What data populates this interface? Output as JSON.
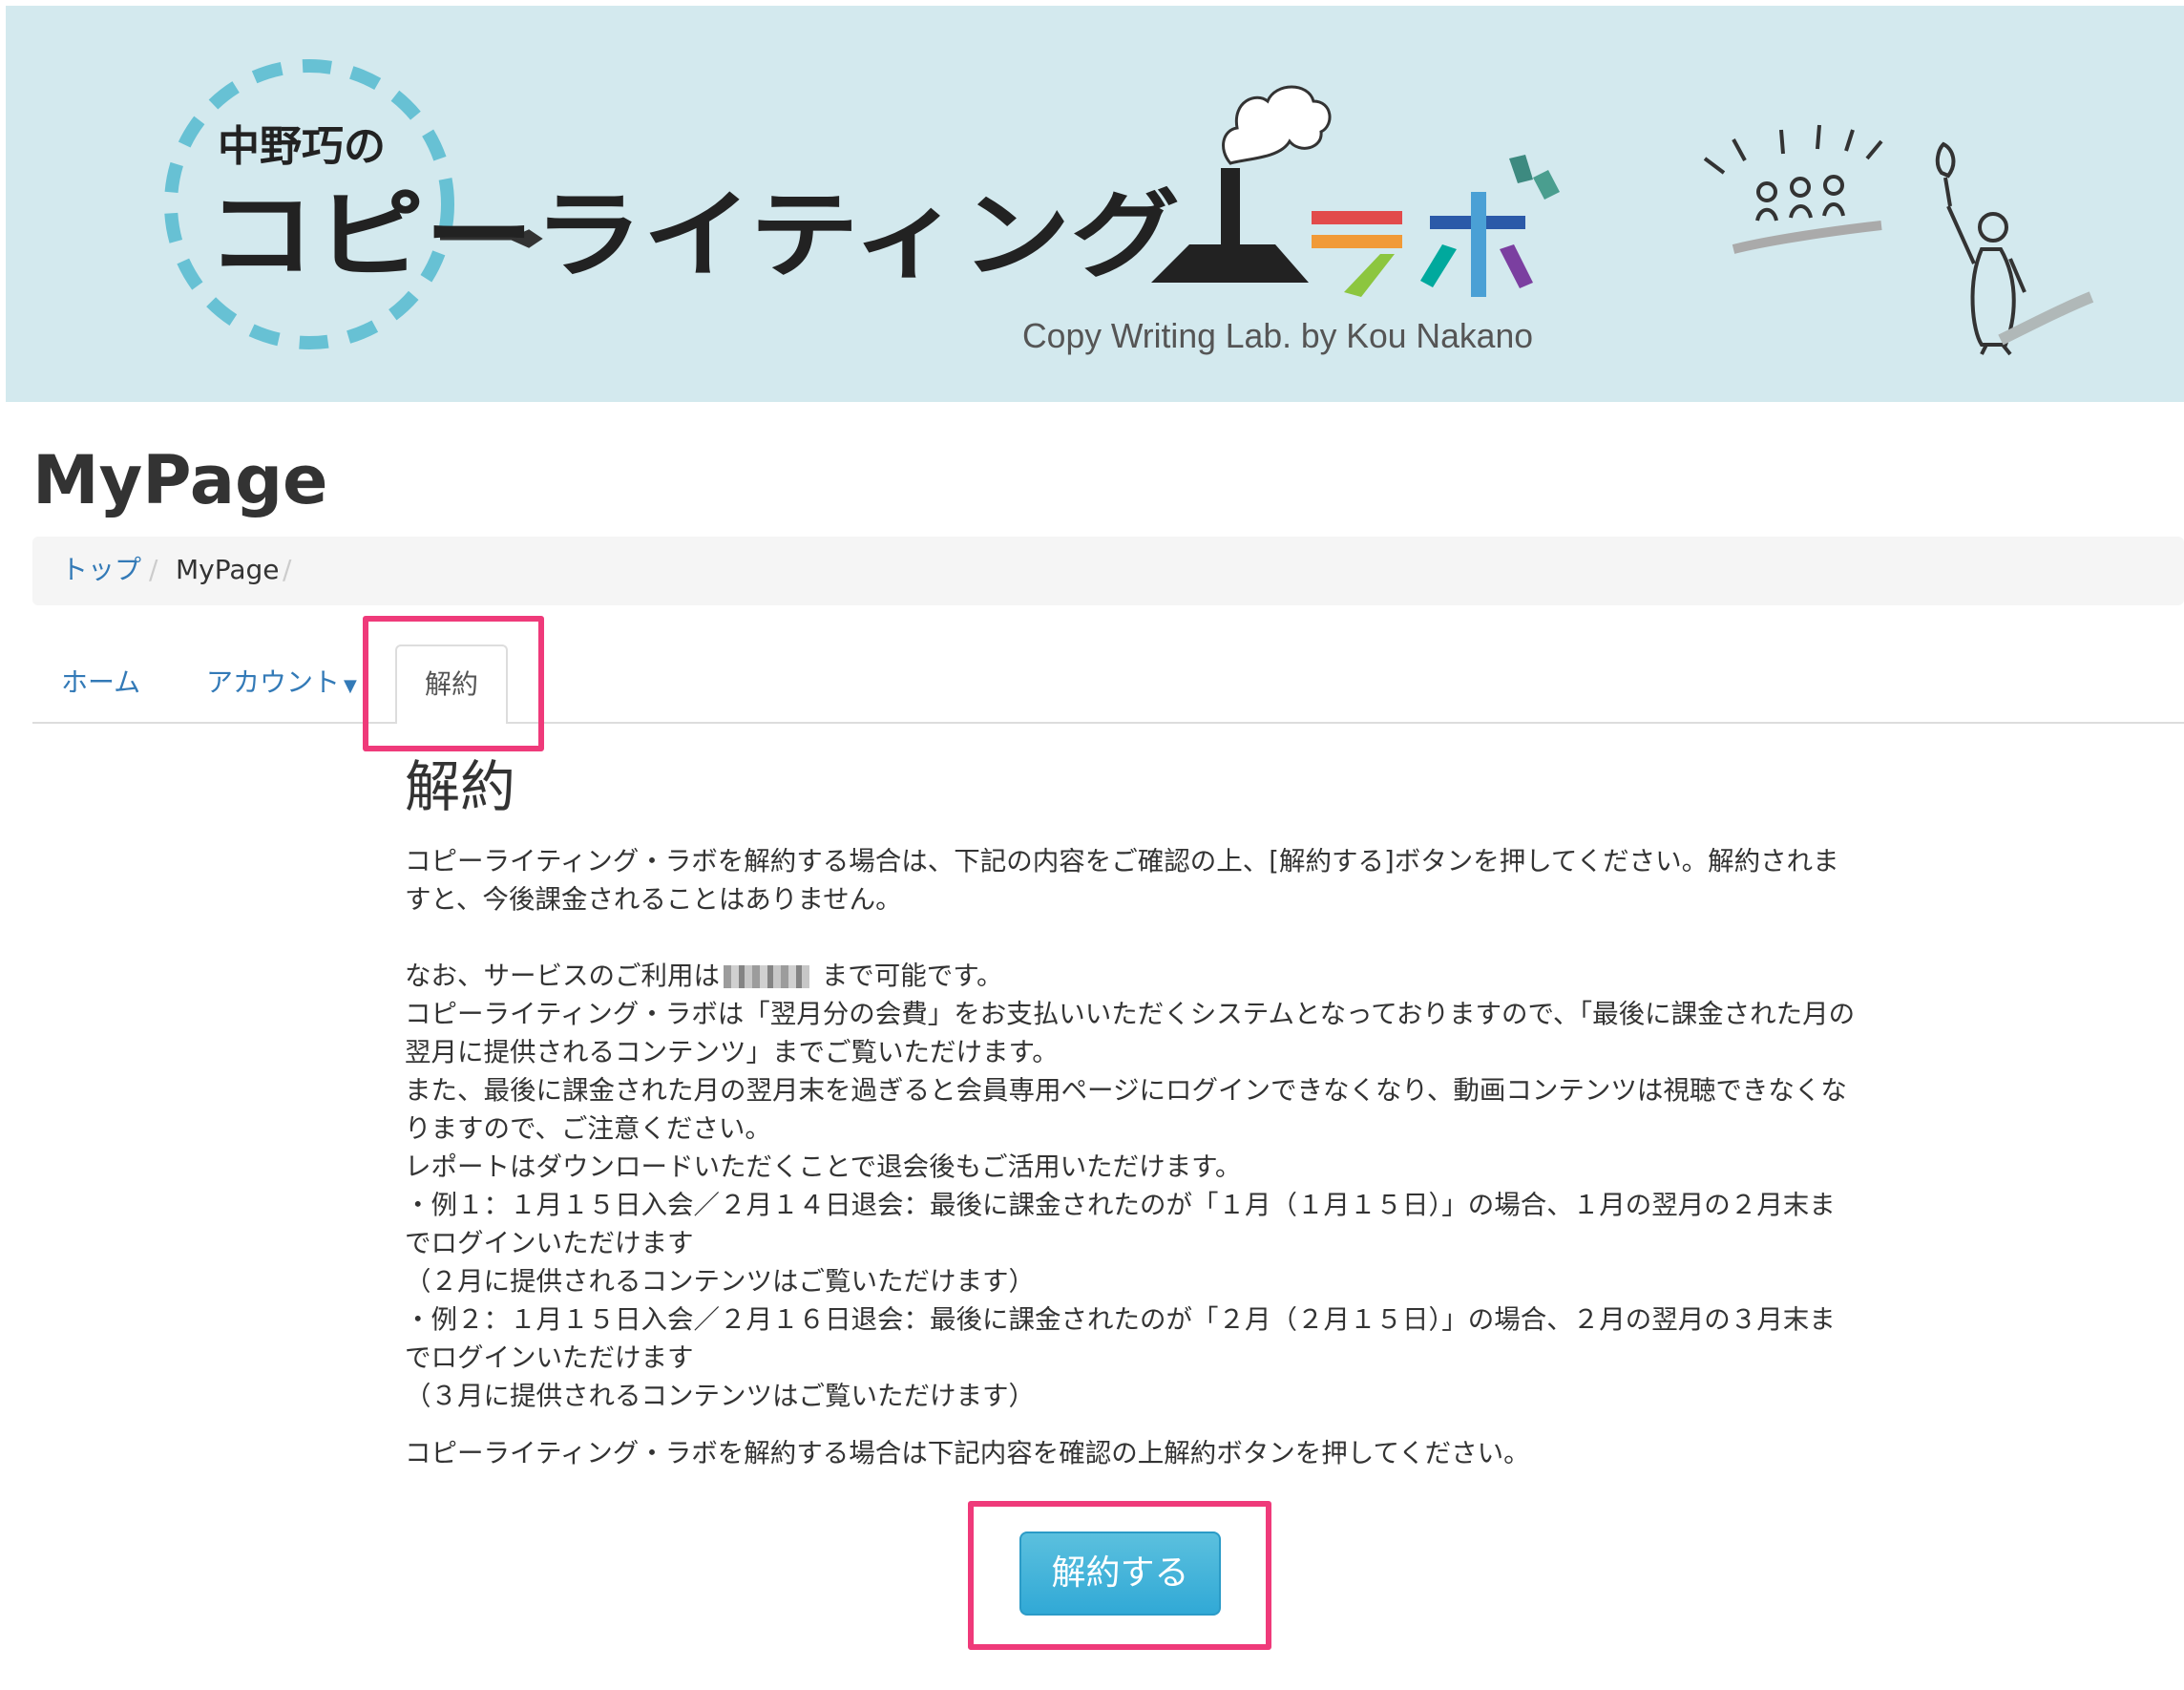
{
  "banner": {
    "logo_prefix": "中野巧の",
    "logo_main": "コピーライティング",
    "logo_lab": "ラボ",
    "logo_subtitle": "Copy Writing Lab. by Kou Nakano"
  },
  "page": {
    "title": "MyPage"
  },
  "breadcrumb": {
    "items": [
      {
        "label": "トップ"
      },
      {
        "label": "MyPage"
      }
    ],
    "separator": "/"
  },
  "tabs": [
    {
      "label": "ホーム"
    },
    {
      "label": "アカウント"
    },
    {
      "label": "解約"
    }
  ],
  "content": {
    "heading": "解約",
    "intro": "コピーライティング・ラボを解約する場合は、下記の内容をご確認の上、[解約する]ボタンを押してください。解約されますと、今後課金されることはありません。",
    "availability_before": "なお、サービスのご利用は",
    "availability_after": " まで可能です。",
    "body": "コピーライティング・ラボは「翌月分の会費」をお支払いいただくシステムとなっておりますので、「最後に課金された月の翌月に提供されるコンテンツ」までご覧いただけます。\nまた、最後に課金された月の翌月末を過ぎると会員専用ページにログインできなくなり、動画コンテンツは視聴できなくなりますので、ご注意ください。\nレポートはダウンロードいただくことで退会後もご活用いただけます。\n・例１：１月１５日入会／２月１４日退会：最後に課金されたのが「１月（１月１５日）」の場合、１月の翌月の２月末までログインいただけます\n（２月に提供されるコンテンツはご覧いただけます）\n・例２：１月１５日入会／２月１６日退会：最後に課金されたのが「２月（２月１５日）」の場合、２月の翌月の３月末までログインいただけます\n（３月に提供されるコンテンツはご覧いただけます）",
    "confirm_note": "コピーライティング・ラボを解約する場合は下記内容を確認の上解約ボタンを押してください。",
    "submit_label": "解約する"
  },
  "colors": {
    "link": "#337ab7",
    "highlight": "#ef3a7a",
    "button": "#31a9d6",
    "banner_bg": "#d3e9ee"
  }
}
